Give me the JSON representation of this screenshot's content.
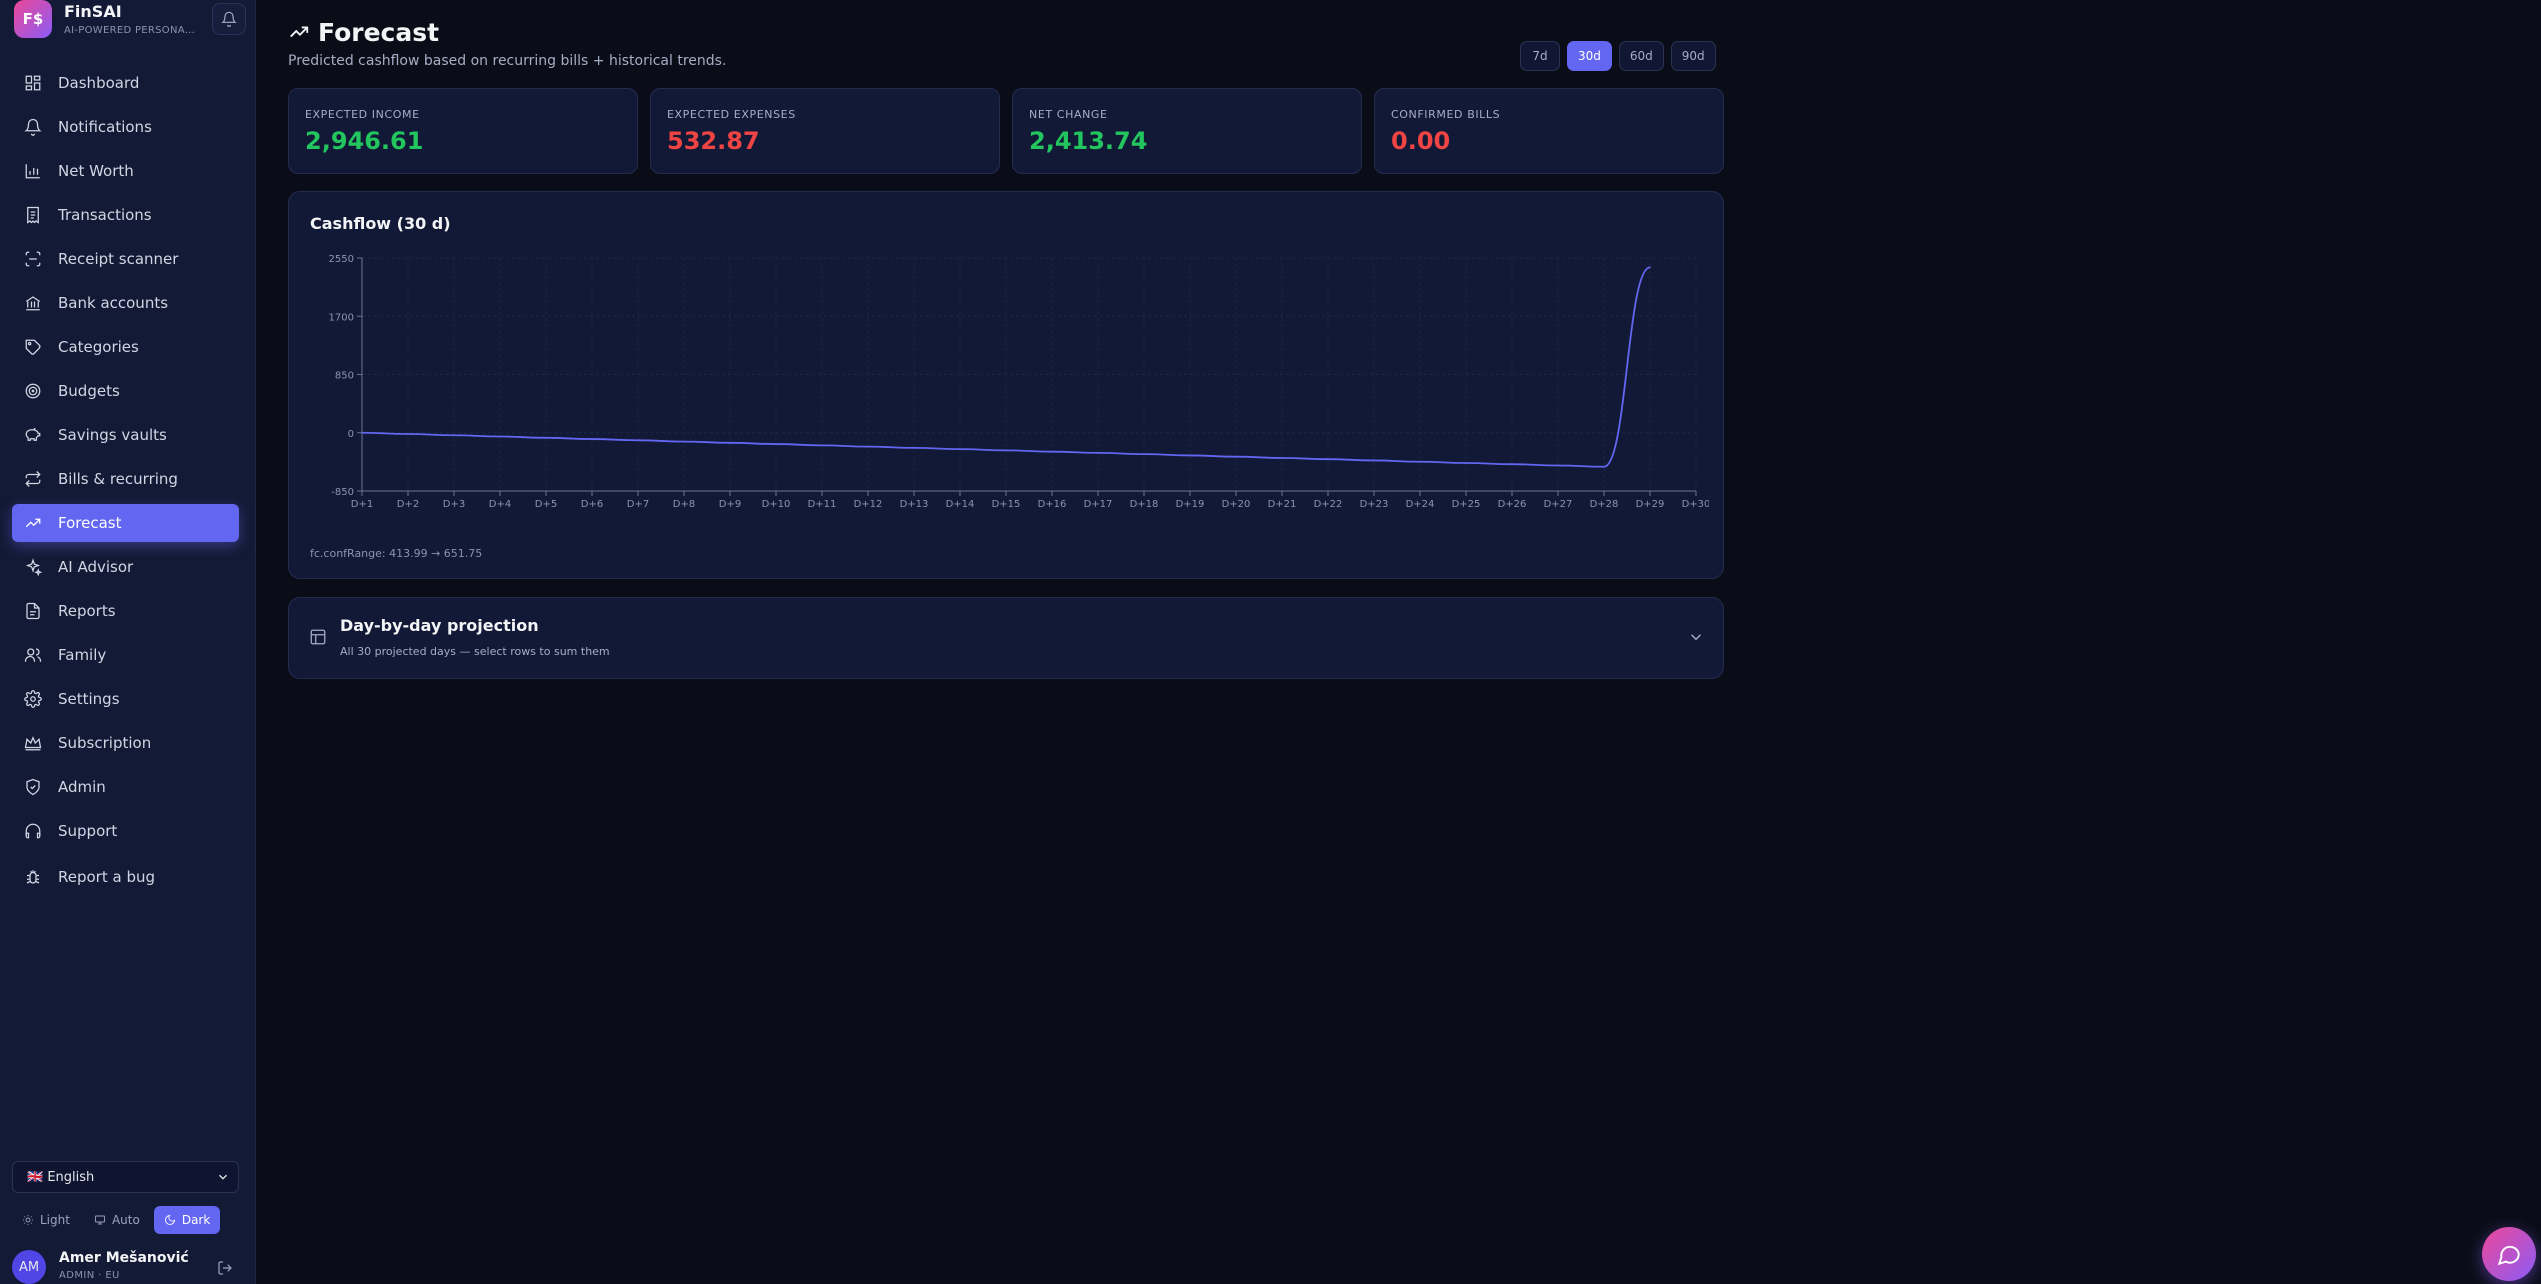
{
  "brand": {
    "logo_text": "F$",
    "name": "FinSAI",
    "subtitle": "AI-POWERED PERSONAL FINANCE"
  },
  "sidebar": {
    "items": [
      {
        "id": "dashboard",
        "label": "Dashboard",
        "icon": "grid-icon"
      },
      {
        "id": "notifications",
        "label": "Notifications",
        "icon": "bell-icon"
      },
      {
        "id": "net-worth",
        "label": "Net Worth",
        "icon": "bar-chart-icon"
      },
      {
        "id": "transactions",
        "label": "Transactions",
        "icon": "receipt-icon"
      },
      {
        "id": "receipt-scanner",
        "label": "Receipt scanner",
        "icon": "scan-icon"
      },
      {
        "id": "bank-accounts",
        "label": "Bank accounts",
        "icon": "bank-icon"
      },
      {
        "id": "categories",
        "label": "Categories",
        "icon": "tag-icon"
      },
      {
        "id": "budgets",
        "label": "Budgets",
        "icon": "target-icon"
      },
      {
        "id": "savings-vaults",
        "label": "Savings vaults",
        "icon": "piggy-bank-icon"
      },
      {
        "id": "bills-recurring",
        "label": "Bills & recurring",
        "icon": "repeat-icon"
      },
      {
        "id": "forecast",
        "label": "Forecast",
        "icon": "trending-up-icon",
        "active": true
      },
      {
        "id": "ai-advisor",
        "label": "AI Advisor",
        "icon": "sparkles-icon"
      },
      {
        "id": "reports",
        "label": "Reports",
        "icon": "file-icon"
      },
      {
        "id": "family",
        "label": "Family",
        "icon": "users-icon"
      },
      {
        "id": "settings",
        "label": "Settings",
        "icon": "gear-icon"
      },
      {
        "id": "subscription",
        "label": "Subscription",
        "icon": "crown-icon"
      },
      {
        "id": "admin",
        "label": "Admin",
        "icon": "shield-icon"
      },
      {
        "id": "support",
        "label": "Support",
        "icon": "headphones-icon"
      },
      {
        "id": "report-bug",
        "label": "Report a bug",
        "icon": "bug-icon"
      }
    ],
    "language": "🇬🇧 English",
    "theme": {
      "light": "Light",
      "auto": "Auto",
      "dark": "Dark",
      "selected": "dark"
    },
    "user": {
      "initials": "AM",
      "name": "Amer Mešanović",
      "role": "ADMIN · EU"
    }
  },
  "page": {
    "title": "Forecast",
    "subtitle": "Predicted cashflow based on recurring bills + historical trends.",
    "ranges": [
      "7d",
      "30d",
      "60d",
      "90d"
    ],
    "selected_range": "30d"
  },
  "stats": [
    {
      "label": "EXPECTED INCOME",
      "value": "2,946.61",
      "color": "#22c55e"
    },
    {
      "label": "EXPECTED EXPENSES",
      "value": "532.87",
      "color": "#ef4444"
    },
    {
      "label": "NET CHANGE",
      "value": "2,413.74",
      "color": "#22c55e"
    },
    {
      "label": "CONFIRMED BILLS",
      "value": "0.00",
      "color": "#ef4444"
    }
  ],
  "chart": {
    "title": "Cashflow (30 d)",
    "conf_range": "fc.confRange: 413.99 → 651.75"
  },
  "chart_data": {
    "type": "line",
    "title": "Cashflow (30 d)",
    "x": [
      "D+1",
      "D+2",
      "D+3",
      "D+4",
      "D+5",
      "D+6",
      "D+7",
      "D+8",
      "D+9",
      "D+10",
      "D+11",
      "D+12",
      "D+13",
      "D+14",
      "D+15",
      "D+16",
      "D+17",
      "D+18",
      "D+19",
      "D+20",
      "D+21",
      "D+22",
      "D+23",
      "D+24",
      "D+25",
      "D+26",
      "D+27",
      "D+28",
      "D+29",
      "D+30"
    ],
    "series": [
      {
        "values": [
          0,
          -18,
          -37,
          -55,
          -74,
          -92,
          -110,
          -129,
          -147,
          -165,
          -184,
          -202,
          -221,
          -239,
          -257,
          -276,
          -294,
          -312,
          -331,
          -349,
          -368,
          -386,
          -404,
          -423,
          -441,
          -459,
          -478,
          -496,
          2413.74,
          null
        ],
        "color": "#6366f1"
      }
    ],
    "yticks": [
      -850,
      0,
      850,
      1700,
      2550
    ],
    "ylim": [
      -850,
      2550
    ],
    "grid": true
  },
  "projection": {
    "title": "Day-by-day projection",
    "subtitle": "All 30 projected days — select rows to sum them"
  }
}
